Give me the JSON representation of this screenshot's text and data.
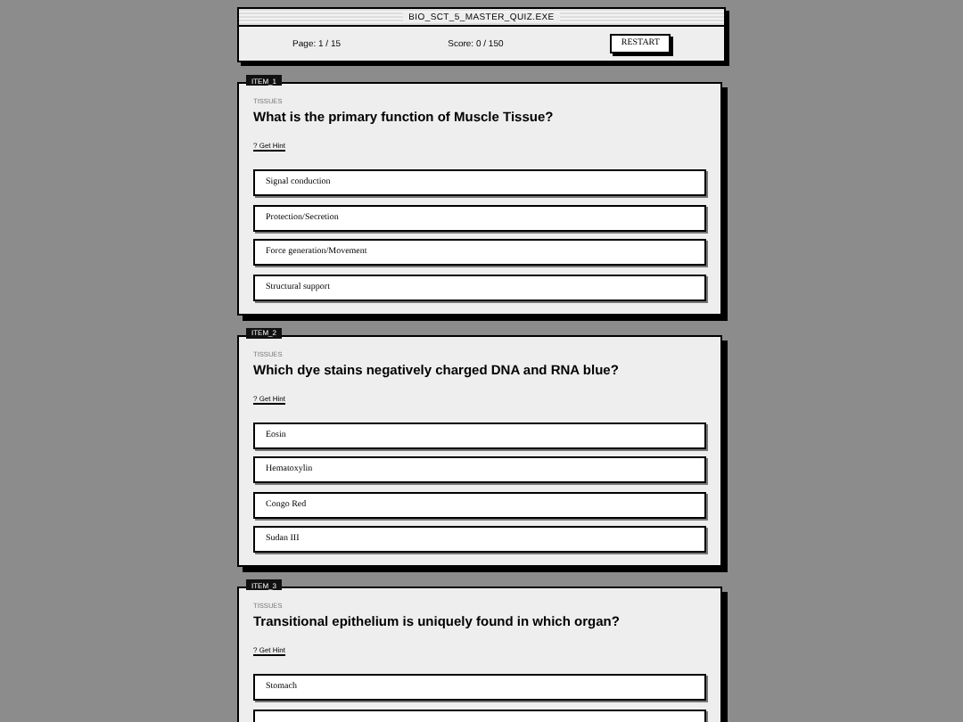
{
  "window": {
    "title": "BIO_SCT_5_MASTER_QUIZ.EXE"
  },
  "header": {
    "page": "Page: 1 / 15",
    "score": "Score: 0 / 150",
    "restart": "RESTART"
  },
  "items": [
    {
      "tag": "ITEM_1",
      "category": "TISSUES",
      "question": "What is the primary function of Muscle Tissue?",
      "hint": "? Get Hint",
      "options": [
        "Signal conduction",
        "Protection/Secretion",
        "Force generation/Movement",
        "Structural support"
      ]
    },
    {
      "tag": "ITEM_2",
      "category": "TISSUES",
      "question": "Which dye stains negatively charged DNA and RNA blue?",
      "hint": "? Get Hint",
      "options": [
        "Eosin",
        "Hematoxylin",
        "Congo Red",
        "Sudan III"
      ]
    },
    {
      "tag": "ITEM_3",
      "category": "TISSUES",
      "question": "Transitional epithelium is uniquely found in which organ?",
      "hint": "? Get Hint",
      "options": [
        "Stomach"
      ],
      "more_below": true
    }
  ]
}
